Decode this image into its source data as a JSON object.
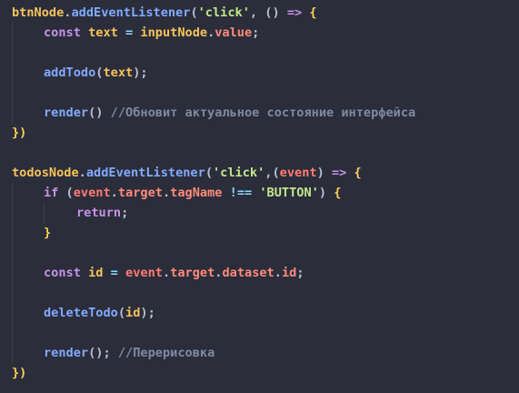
{
  "editor": {
    "lines": [
      [
        {
          "t": "btnNode",
          "c": "ident"
        },
        {
          "t": ".",
          "c": "punc"
        },
        {
          "t": "addEventListener",
          "c": "method"
        },
        {
          "t": "(",
          "c": "punc"
        },
        {
          "t": "'click'",
          "c": "str"
        },
        {
          "t": ", ",
          "c": "punc"
        },
        {
          "t": "()",
          "c": "punc"
        },
        {
          "t": " ",
          "c": "plain"
        },
        {
          "t": "=>",
          "c": "kw"
        },
        {
          "t": " {",
          "c": "brace"
        }
      ],
      [
        {
          "t": "const",
          "c": "kw"
        },
        {
          "t": " text ",
          "c": "var"
        },
        {
          "t": "=",
          "c": "op"
        },
        {
          "t": " inputNode",
          "c": "ident"
        },
        {
          "t": ".",
          "c": "punc"
        },
        {
          "t": "value",
          "c": "prop"
        },
        {
          "t": ";",
          "c": "punc"
        }
      ],
      [],
      [
        {
          "t": "addTodo",
          "c": "call"
        },
        {
          "t": "(",
          "c": "punc"
        },
        {
          "t": "text",
          "c": "ident"
        },
        {
          "t": ");",
          "c": "punc"
        }
      ],
      [],
      [
        {
          "t": "render",
          "c": "call"
        },
        {
          "t": "()",
          "c": "punc"
        },
        {
          "t": " //Обновит актуальное состояние интерфейса",
          "c": "cmt"
        }
      ],
      [
        {
          "t": "})",
          "c": "brace"
        }
      ],
      [],
      [
        {
          "t": "todosNode",
          "c": "ident"
        },
        {
          "t": ".",
          "c": "punc"
        },
        {
          "t": "addEventListener",
          "c": "method"
        },
        {
          "t": "(",
          "c": "punc"
        },
        {
          "t": "'click'",
          "c": "str"
        },
        {
          "t": ",",
          "c": "punc"
        },
        {
          "t": "(",
          "c": "punc"
        },
        {
          "t": "event",
          "c": "param"
        },
        {
          "t": ")",
          "c": "punc"
        },
        {
          "t": " ",
          "c": "plain"
        },
        {
          "t": "=>",
          "c": "kw"
        },
        {
          "t": " {",
          "c": "brace"
        }
      ],
      [
        {
          "t": "if",
          "c": "kw"
        },
        {
          "t": " (",
          "c": "punc"
        },
        {
          "t": "event",
          "c": "param"
        },
        {
          "t": ".",
          "c": "punc"
        },
        {
          "t": "target",
          "c": "prop"
        },
        {
          "t": ".",
          "c": "punc"
        },
        {
          "t": "tagName",
          "c": "prop"
        },
        {
          "t": " !== ",
          "c": "op"
        },
        {
          "t": "'BUTTON'",
          "c": "str"
        },
        {
          "t": ")",
          "c": "punc"
        },
        {
          "t": " {",
          "c": "brace"
        }
      ],
      [
        {
          "t": "return",
          "c": "kw"
        },
        {
          "t": ";",
          "c": "punc"
        }
      ],
      [
        {
          "t": "}",
          "c": "brace"
        }
      ],
      [],
      [
        {
          "t": "const",
          "c": "kw"
        },
        {
          "t": " id ",
          "c": "var"
        },
        {
          "t": "=",
          "c": "op"
        },
        {
          "t": " event",
          "c": "param"
        },
        {
          "t": ".",
          "c": "punc"
        },
        {
          "t": "target",
          "c": "prop"
        },
        {
          "t": ".",
          "c": "punc"
        },
        {
          "t": "dataset",
          "c": "prop"
        },
        {
          "t": ".",
          "c": "punc"
        },
        {
          "t": "id",
          "c": "prop"
        },
        {
          "t": ";",
          "c": "punc"
        }
      ],
      [],
      [
        {
          "t": "deleteTodo",
          "c": "call"
        },
        {
          "t": "(",
          "c": "punc"
        },
        {
          "t": "id",
          "c": "ident"
        },
        {
          "t": ");",
          "c": "punc"
        }
      ],
      [],
      [
        {
          "t": "render",
          "c": "call"
        },
        {
          "t": "();",
          "c": "punc"
        },
        {
          "t": " //Перерисовка",
          "c": "cmt"
        }
      ],
      [
        {
          "t": "})",
          "c": "brace"
        }
      ]
    ]
  }
}
